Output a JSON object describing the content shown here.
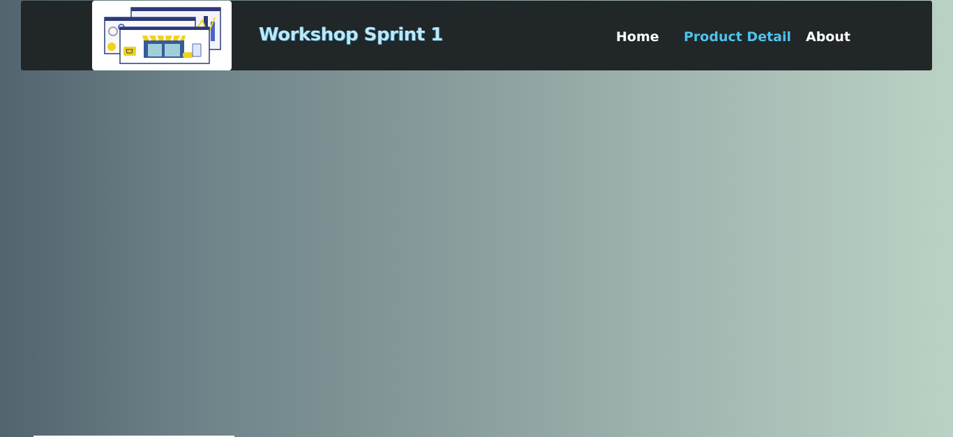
{
  "header": {
    "logo": {
      "icon": "storefront-illustration-icon"
    },
    "title": "Workshop Sprint 1",
    "nav": [
      {
        "label": "Home",
        "active": false
      },
      {
        "label": "Product Detail",
        "active": true
      },
      {
        "label": "About",
        "active": false
      }
    ]
  },
  "colors": {
    "navbar_bg": "#212628",
    "title": "#bde7f7",
    "nav_active": "#4ec3ea",
    "nav_default": "#ffffff",
    "gradient_start": "#52646f",
    "gradient_end": "#bad2c4"
  }
}
